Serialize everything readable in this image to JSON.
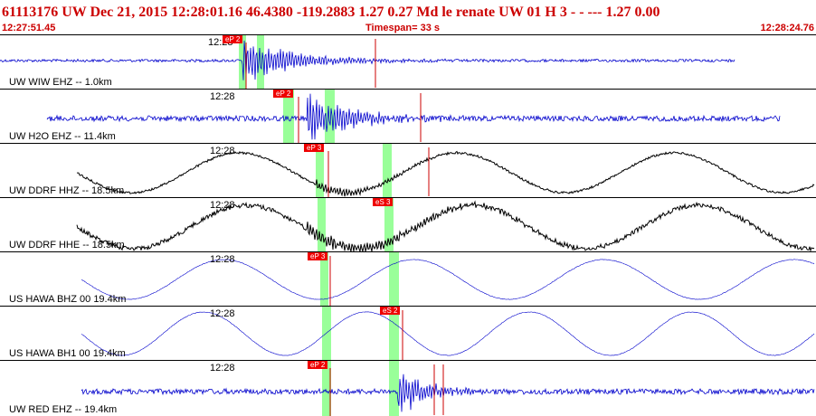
{
  "header": {
    "title": "61113176 UW Dec 21, 2015 12:28:01.16   46.4380 -119.2883  1.27 0.27 Md le    renate    UW 01 H    3   -  - ---   1.27 0.00",
    "start_time": "12:27:51.45",
    "timespan": "Timespan=  33 s",
    "end_time": "12:28:24.76"
  },
  "colors": {
    "header_text": "#cc0000",
    "blue_trace": "#0000cc",
    "black_trace": "#000000",
    "pick_box": "#ee0000",
    "window": "#99ff99",
    "marker": "#cc0000"
  },
  "traces": [
    {
      "label": "UW WIW EHZ -- 1.0km",
      "tick": "12:28",
      "color": "blue",
      "pick": "eP 2",
      "pick_s2": ""
    },
    {
      "label": "UW H2O EHZ -- 11.4km",
      "tick": "12:28",
      "color": "blue",
      "pick": "eP 2",
      "pick_s2": ""
    },
    {
      "label": "UW DDRF HHZ -- 18.5km",
      "tick": "12:28",
      "color": "black",
      "pick": "eP 3",
      "pick_s2": ""
    },
    {
      "label": "UW DDRF HHE -- 18.5km",
      "tick": "12:28",
      "color": "black",
      "pick": "eS 3",
      "pick_s2": ""
    },
    {
      "label": "US HAWA BHZ 00 19.4km",
      "tick": "12:28",
      "color": "thin",
      "pick": "eP 3",
      "pick_s2": ""
    },
    {
      "label": "US HAWA BH1 00 19.4km",
      "tick": "12:28",
      "color": "thin",
      "pick": "eS 2",
      "pick_s2": ""
    },
    {
      "label": "UW RED EHZ -- 19.4km",
      "tick": "12:28",
      "color": "blue",
      "pick": "eP 2",
      "pick_s2": ""
    }
  ]
}
